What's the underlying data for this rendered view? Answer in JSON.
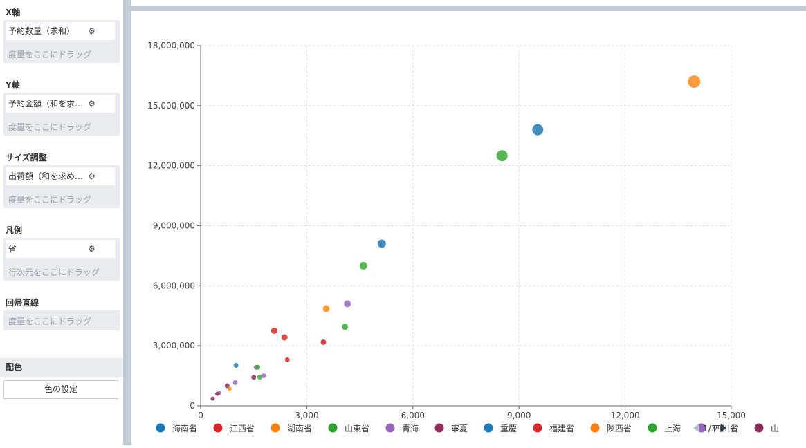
{
  "panel": {
    "x_axis": {
      "title": "X軸",
      "chip": "予約数量（求和）",
      "drop": "度量をここにドラッグ"
    },
    "y_axis": {
      "title": "Y軸",
      "chip": "予約金額（和を求…",
      "drop": "度量をここにドラッグ"
    },
    "size": {
      "title": "サイズ調整",
      "chip": "出荷額（和を求め…",
      "drop": "度量をここにドラッグ"
    },
    "legend": {
      "title": "凡例",
      "chip": "省",
      "drop": "行次元をここにドラッグ"
    },
    "regression": {
      "title": "回帰直線",
      "drop": "度量をここにドラッグ"
    },
    "color": {
      "title": "配色",
      "button": "色の設定"
    }
  },
  "icons": {
    "gear": "gear-icon",
    "legend_prev": "triangle-left-icon",
    "legend_next": "triangle-right-icon"
  },
  "chart_data": {
    "type": "scatter",
    "xlim": [
      0,
      15000
    ],
    "ylim": [
      0,
      18000000
    ],
    "x_ticks": [
      "0",
      "3,000",
      "6,000",
      "9,000",
      "12,000",
      "15,000"
    ],
    "y_ticks": [
      "0",
      "3,000,000",
      "6,000,000",
      "9,000,000",
      "12,000,000",
      "15,000,000",
      "18,000,000"
    ],
    "grid": true,
    "legend_position": "bottom",
    "legend": [
      {
        "name": "海南省",
        "color": "#1f77b4"
      },
      {
        "name": "江西省",
        "color": "#d62728"
      },
      {
        "name": "湖南省",
        "color": "#ff7f0e"
      },
      {
        "name": "山東省",
        "color": "#2ca02c"
      },
      {
        "name": "青海",
        "color": "#9467bd"
      },
      {
        "name": "寧夏",
        "color": "#8c2d5a"
      },
      {
        "name": "重慶",
        "color": "#1f77b4"
      },
      {
        "name": "福建省",
        "color": "#d62728"
      },
      {
        "name": "陝西省",
        "color": "#ff7f0e"
      },
      {
        "name": "上海",
        "color": "#2ca02c"
      },
      {
        "name": "四川省",
        "color": "#9467bd"
      },
      {
        "name": "山",
        "color": "#8c2d5a"
      }
    ],
    "legend_page": "1/3",
    "points": [
      {
        "x": 13950,
        "y": 16200000,
        "r": 9,
        "color": "#ff8c1a"
      },
      {
        "x": 9530,
        "y": 13800000,
        "r": 8,
        "color": "#1f77b4"
      },
      {
        "x": 8520,
        "y": 12500000,
        "r": 8,
        "color": "#3aaa35"
      },
      {
        "x": 5120,
        "y": 8100000,
        "r": 6,
        "color": "#1f77b4"
      },
      {
        "x": 4600,
        "y": 7000000,
        "r": 5.5,
        "color": "#3aaa35"
      },
      {
        "x": 4150,
        "y": 5100000,
        "r": 5,
        "color": "#9467bd"
      },
      {
        "x": 3550,
        "y": 4850000,
        "r": 5,
        "color": "#ff8c1a"
      },
      {
        "x": 4080,
        "y": 3950000,
        "r": 4.5,
        "color": "#3aaa35"
      },
      {
        "x": 2080,
        "y": 3750000,
        "r": 4.5,
        "color": "#d62728"
      },
      {
        "x": 2370,
        "y": 3420000,
        "r": 4.5,
        "color": "#d62728"
      },
      {
        "x": 3470,
        "y": 3180000,
        "r": 4,
        "color": "#d62728"
      },
      {
        "x": 2450,
        "y": 2300000,
        "r": 3.5,
        "color": "#d62728"
      },
      {
        "x": 1000,
        "y": 2020000,
        "r": 3.5,
        "color": "#1f77b4"
      },
      {
        "x": 1570,
        "y": 1920000,
        "r": 3.5,
        "color": "#9467bd"
      },
      {
        "x": 1620,
        "y": 1930000,
        "r": 3.5,
        "color": "#3aaa35"
      },
      {
        "x": 1780,
        "y": 1500000,
        "r": 3.5,
        "color": "#9467bd"
      },
      {
        "x": 1670,
        "y": 1430000,
        "r": 3.5,
        "color": "#3aaa35"
      },
      {
        "x": 1500,
        "y": 1420000,
        "r": 3.5,
        "color": "#8c2d5a"
      },
      {
        "x": 980,
        "y": 1160000,
        "r": 3.5,
        "color": "#9467bd"
      },
      {
        "x": 750,
        "y": 1000000,
        "r": 3.5,
        "color": "#8c2d5a"
      },
      {
        "x": 820,
        "y": 850000,
        "r": 3,
        "color": "#ff8c1a"
      },
      {
        "x": 530,
        "y": 640000,
        "r": 3,
        "color": "#9467bd"
      },
      {
        "x": 470,
        "y": 600000,
        "r": 3,
        "color": "#8c2d5a"
      },
      {
        "x": 340,
        "y": 360000,
        "r": 3,
        "color": "#8c2d5a"
      }
    ]
  }
}
